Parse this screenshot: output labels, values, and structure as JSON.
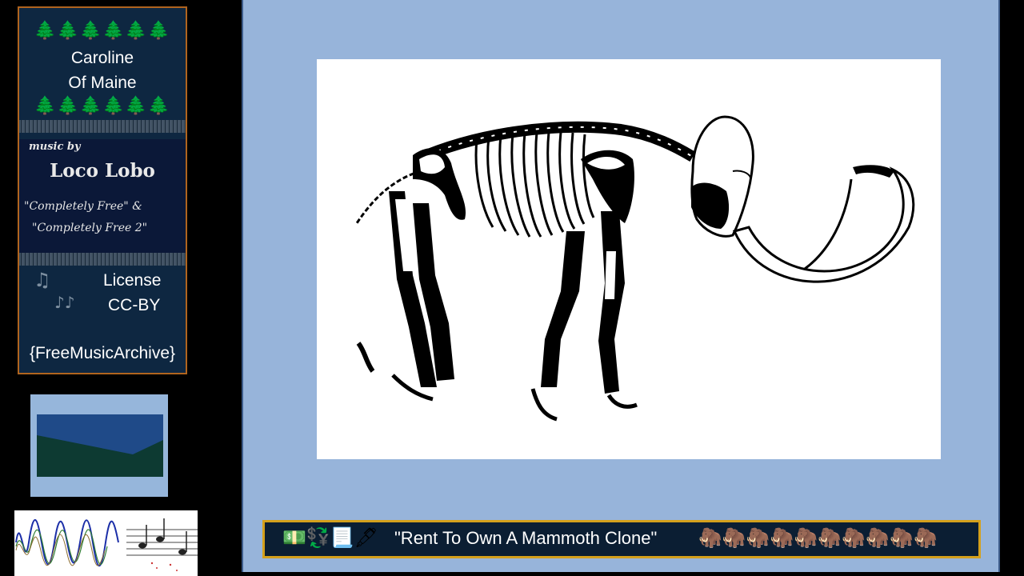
{
  "card": {
    "trees": "🌲🌲🌲🌲🌲🌲",
    "title_line1": "Caroline",
    "title_line2": "Of Maine",
    "music_by": "music by",
    "artist": "Loco Lobo",
    "album_line1": "\"Completely Free\" &",
    "album_line2": "\"Completely Free 2\"",
    "license_label": "License",
    "license_value": "CC-BY",
    "note_icon": "musical-note-icon",
    "notes_icon": "musical-notes-icon",
    "source": "{FreeMusicArchive}"
  },
  "song_bar": {
    "icons": "💵💱📃🖋",
    "title": "\"Rent To Own A Mammoth Clone\"",
    "mammoths": "🦣🦣🦣🦣🦣🦣🦣🦣🦣🦣",
    "border_color": "#d4a01c"
  },
  "image": {
    "subject": "mammoth-skeleton-illustration"
  },
  "colors": {
    "card_bg": "#0e2741",
    "card_border": "#b0641e",
    "stage_bg": "#97b4da"
  }
}
